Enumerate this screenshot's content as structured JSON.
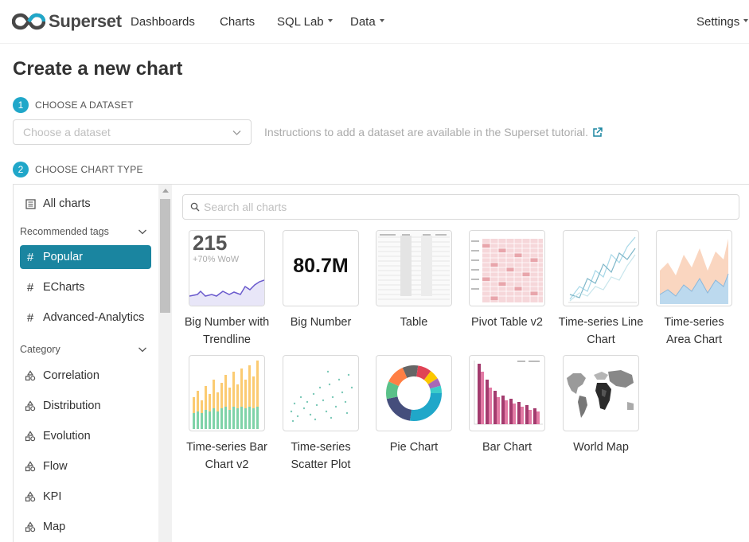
{
  "brand": {
    "name": "Superset",
    "logo_color": "#484848"
  },
  "nav": {
    "items": [
      {
        "label": "Dashboards",
        "dropdown": false
      },
      {
        "label": "Charts",
        "dropdown": false
      },
      {
        "label": "SQL Lab",
        "dropdown": true
      },
      {
        "label": "Data",
        "dropdown": true
      }
    ],
    "settings": {
      "label": "Settings",
      "dropdown": true
    }
  },
  "page": {
    "title": "Create a new chart"
  },
  "steps": [
    {
      "number": "1",
      "label": "CHOOSE A DATASET"
    },
    {
      "number": "2",
      "label": "CHOOSE CHART TYPE"
    }
  ],
  "dataset": {
    "placeholder": "Choose a dataset",
    "hint": "Instructions to add a dataset are available in the Superset tutorial."
  },
  "sidebar": {
    "all_charts": "All charts",
    "recommended_title": "Recommended tags",
    "tags": [
      {
        "label": "Popular",
        "active": true
      },
      {
        "label": "ECharts",
        "active": false
      },
      {
        "label": "Advanced-Analytics",
        "active": false
      }
    ],
    "category_title": "Category",
    "categories": [
      "Correlation",
      "Distribution",
      "Evolution",
      "Flow",
      "KPI",
      "Map"
    ]
  },
  "search": {
    "placeholder": "Search all charts"
  },
  "charts": [
    {
      "name": "Big Number with Trendline",
      "icon": "big-number-trendline-thumb",
      "preview_value": "215",
      "preview_sub": "+70% WoW"
    },
    {
      "name": "Big Number",
      "icon": "big-number-thumb",
      "preview_value": "80.7M"
    },
    {
      "name": "Table",
      "icon": "table-thumb"
    },
    {
      "name": "Pivot Table v2",
      "icon": "pivot-table-thumb"
    },
    {
      "name": "Time-series Line Chart",
      "icon": "line-chart-thumb"
    },
    {
      "name": "Time-series Area Chart",
      "icon": "area-chart-thumb"
    },
    {
      "name": "Time-series Bar Chart v2",
      "icon": "bar-chart-v2-thumb"
    },
    {
      "name": "Time-series Scatter Plot",
      "icon": "scatter-plot-thumb"
    },
    {
      "name": "Pie Chart",
      "icon": "pie-chart-thumb"
    },
    {
      "name": "Bar Chart",
      "icon": "bar-chart-thumb"
    },
    {
      "name": "World Map",
      "icon": "world-map-thumb"
    }
  ],
  "colors": {
    "accent": "#20a7c9",
    "active_tag": "#1a85a0",
    "link": "#1a85a0"
  }
}
